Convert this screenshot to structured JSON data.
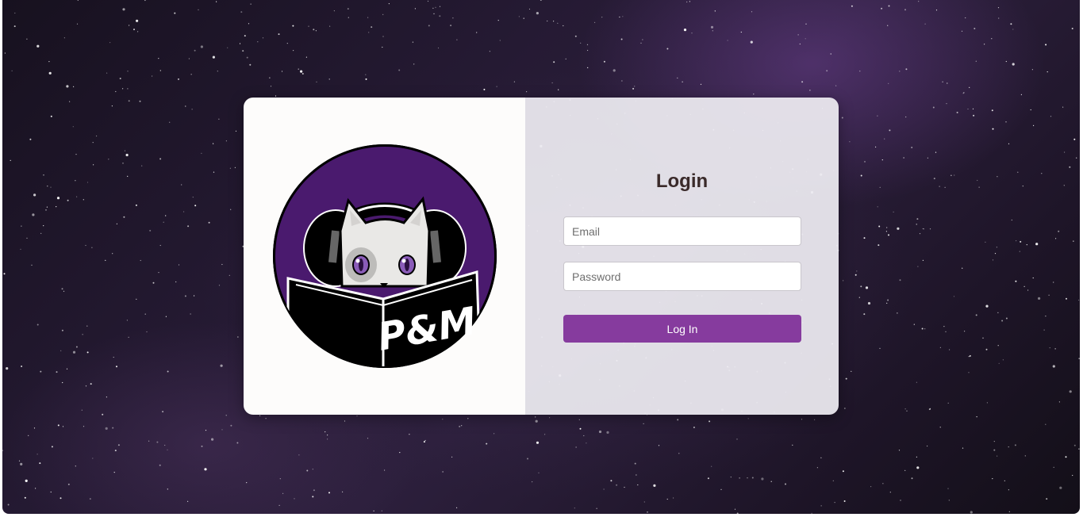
{
  "login": {
    "title": "Login",
    "email_placeholder": "Email",
    "password_placeholder": "Password",
    "submit_label": "Log In"
  },
  "logo": {
    "text": "P&M",
    "icon": "cat-reading-book-with-headphones-icon"
  },
  "colors": {
    "accent": "#863b9e",
    "logo_circle": "#4a1a6e",
    "background": "#251a33"
  }
}
